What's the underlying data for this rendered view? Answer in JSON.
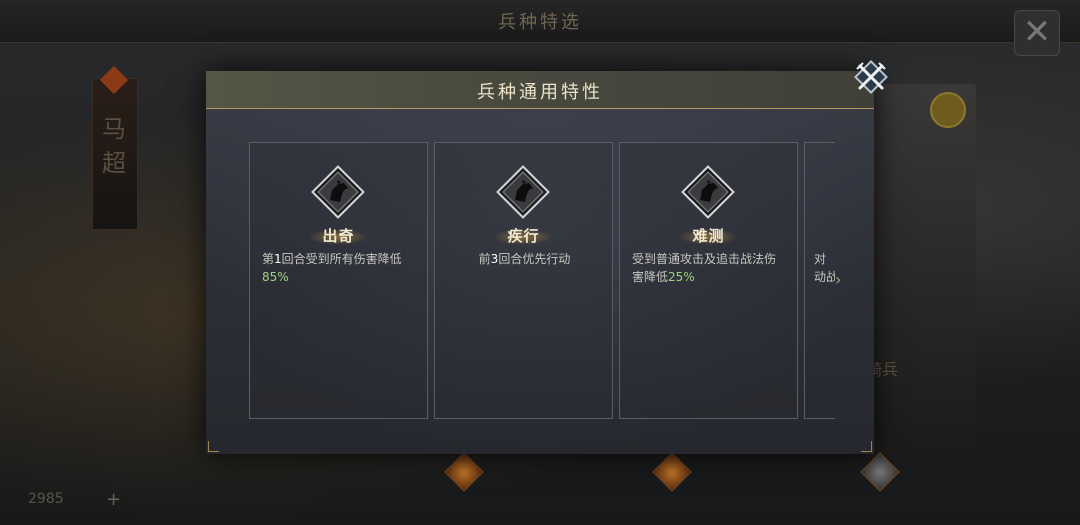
{
  "background": {
    "title": "兵种特选",
    "banner_text": "马超",
    "unit_label": "铁骑兵",
    "currency": "2985",
    "plus": "+",
    "close_glyph": "✕"
  },
  "modal": {
    "title": "兵种通用特性",
    "close_icon": "crossed-swords-icon",
    "next_arrow": "›",
    "cards": [
      {
        "name": "出奇",
        "icon": "horse-head-icon",
        "desc_prefix": "第",
        "desc_num": "1",
        "desc_mid": "回合受到所有伤害降低",
        "desc_pct": "85%"
      },
      {
        "name": "疾行",
        "icon": "horse-head-icon",
        "desc_prefix": "前",
        "desc_num": "3",
        "desc_mid": "回合优先行动"
      },
      {
        "name": "难测",
        "icon": "horse-head-icon",
        "desc_line1": "受到普通攻击及追击战法伤",
        "desc_line2": "害降低",
        "desc_pct": "25%"
      }
    ],
    "partial_card": {
      "line1": "对",
      "line2": "动战"
    }
  },
  "colors": {
    "gold": "#b49a5c",
    "highlight_green": "#9fd27a",
    "title_text": "#ece2c8"
  }
}
